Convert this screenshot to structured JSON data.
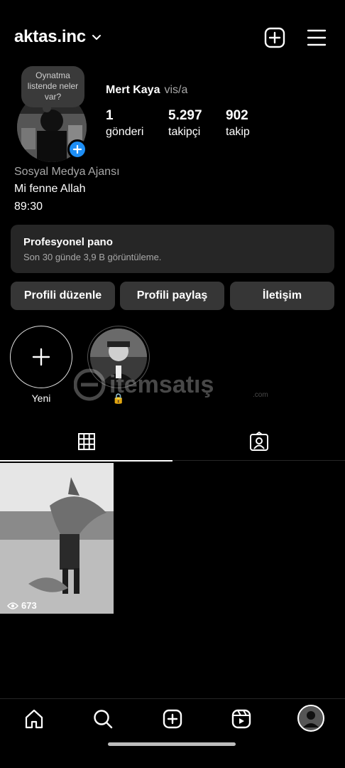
{
  "header": {
    "username": "aktas.inc"
  },
  "note": {
    "text": "Oynatma listende neler var?"
  },
  "profile": {
    "name": "Mert Kaya",
    "pronoun": "vis/a",
    "stats": [
      {
        "value": "1",
        "label": "gönderi"
      },
      {
        "value": "5.297",
        "label": "takipçi"
      },
      {
        "value": "902",
        "label": "takip"
      }
    ],
    "category": "Sosyal Medya Ajansı",
    "bio_lines": [
      "Mi fenne Allah",
      "89:30"
    ]
  },
  "dashboard": {
    "title": "Profesyonel pano",
    "subtitle": "Son 30 günde 3,9 B görüntüleme."
  },
  "buttons": {
    "edit": "Profili düzenle",
    "share": "Profili paylaş",
    "contact": "İletişim"
  },
  "highlights": [
    {
      "label": "Yeni"
    },
    {
      "label": "🔒"
    }
  ],
  "watermark": {
    "text": "itemsatış",
    "suffix": ".com"
  },
  "tabs": [
    {
      "icon": "grid-icon",
      "active": true
    },
    {
      "icon": "tagged-icon",
      "active": false
    }
  ],
  "posts": [
    {
      "views": "673"
    }
  ],
  "nav": [
    {
      "icon": "home-icon"
    },
    {
      "icon": "search-icon"
    },
    {
      "icon": "create-icon"
    },
    {
      "icon": "reels-icon"
    },
    {
      "icon": "profile-avatar"
    }
  ],
  "colors": {
    "background": "#000000",
    "card": "#262626",
    "button": "#363636",
    "accent": "#1d8ef5",
    "muted": "#a8a8a8"
  }
}
